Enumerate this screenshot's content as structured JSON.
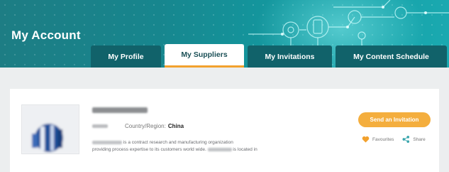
{
  "header": {
    "title": "My Account",
    "tabs": [
      {
        "label": "My Profile",
        "active": false
      },
      {
        "label": "My Suppliers",
        "active": true
      },
      {
        "label": "My Invitations",
        "active": false
      },
      {
        "label": "My Content Schedule",
        "active": false
      }
    ]
  },
  "supplier": {
    "country_label": "Country/Region:",
    "country_value": "China",
    "description_part1": "is a contract research and manufacturing organization",
    "description_part2": "providing process expertise to its customers world wide.",
    "description_part3": "is located in",
    "invite_label": "Send an Invitation",
    "favourites_label": "Favourites",
    "share_label": "Share"
  },
  "colors": {
    "banner": "#17868e",
    "tab_bg": "#11626a",
    "accent": "#f4ae3e",
    "heart": "#f2a12e",
    "share": "#3aa6ad"
  },
  "icons": [
    "heart-icon",
    "share-icon",
    "company-logo"
  ]
}
